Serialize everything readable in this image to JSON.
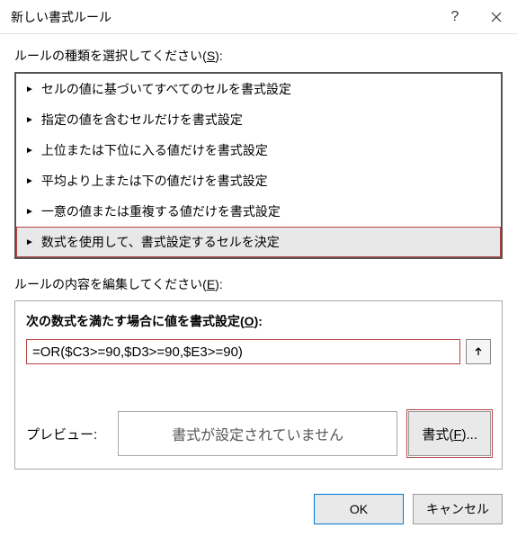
{
  "title": "新しい書式ルール",
  "ruleTypeLabel": "ルールの種類を選択してください(",
  "ruleTypeKey": "S",
  "ruleTypeLabelEnd": "):",
  "ruleItems": [
    "セルの値に基づいてすべてのセルを書式設定",
    "指定の値を含むセルだけを書式設定",
    "上位または下位に入る値だけを書式設定",
    "平均より上または下の値だけを書式設定",
    "一意の値または重複する値だけを書式設定",
    "数式を使用して、書式設定するセルを決定"
  ],
  "selectedIndex": 5,
  "editLabel": "ルールの内容を編集してください(",
  "editKey": "E",
  "editLabelEnd": "):",
  "formulaLabel": "次の数式を満たす場合に値を書式設定(",
  "formulaKey": "O",
  "formulaLabelEnd": "):",
  "formulaValue": "=OR($C3>=90,$D3>=90,$E3>=90)",
  "previewLabel": "プレビュー:",
  "previewText": "書式が設定されていません",
  "formatBtn": "書式(",
  "formatKey": "F",
  "formatBtnEnd": ")...",
  "okLabel": "OK",
  "cancelLabel": "キャンセル"
}
